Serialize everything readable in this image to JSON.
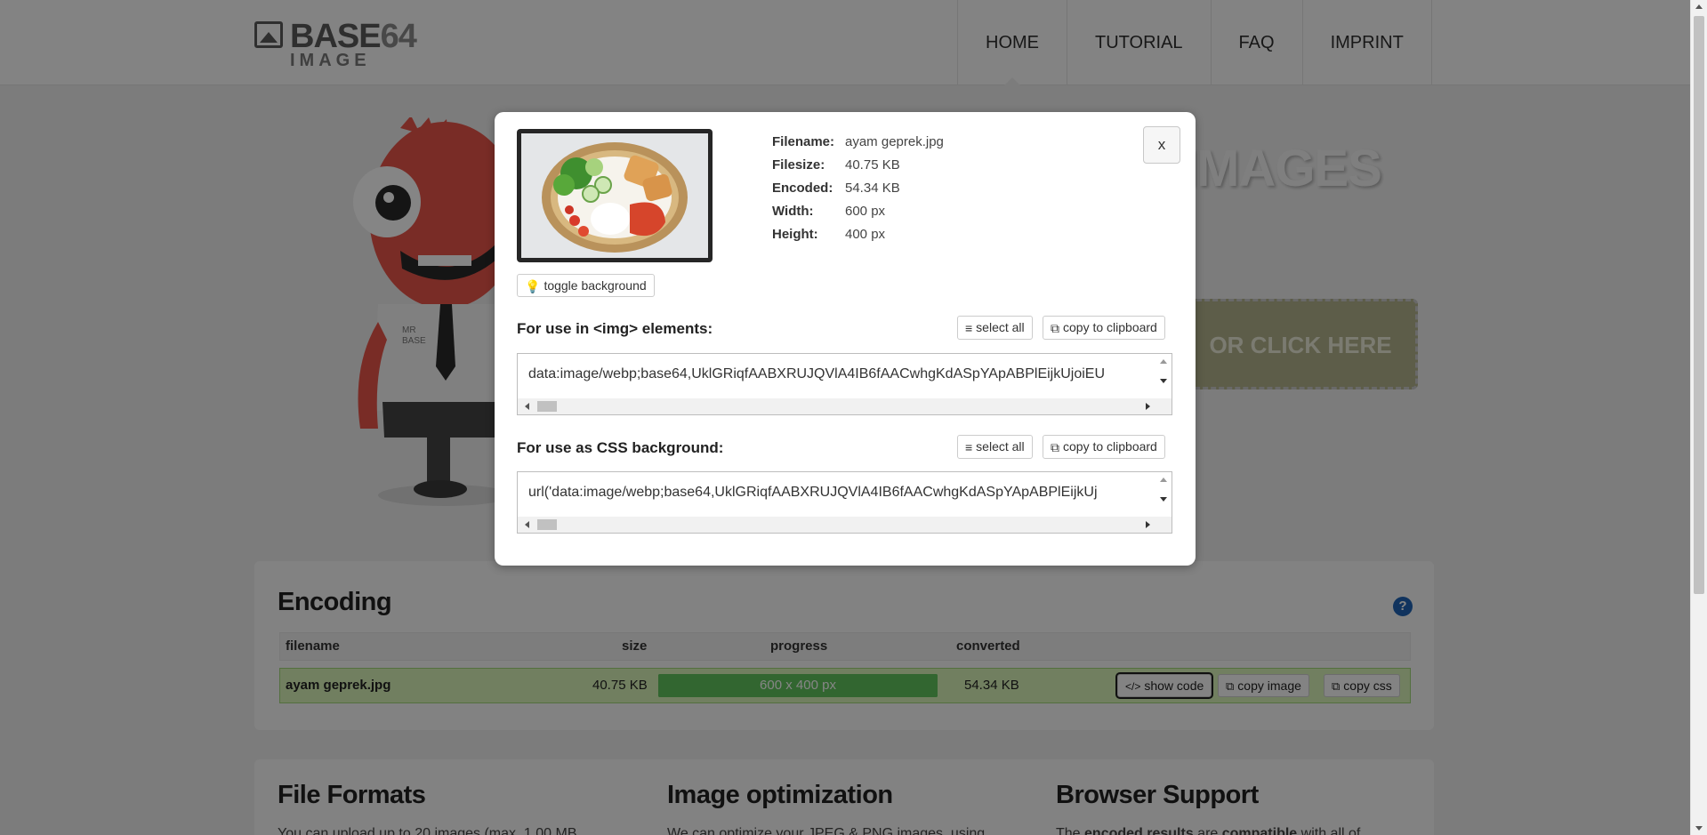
{
  "logo": {
    "main": "BASE",
    "suffix": "64",
    "sub": "IMAGE"
  },
  "nav": [
    {
      "label": "HOME",
      "active": true
    },
    {
      "label": "TUTORIAL",
      "active": false
    },
    {
      "label": "FAQ",
      "active": false
    },
    {
      "label": "IMPRINT",
      "active": false
    }
  ],
  "hero": {
    "title": "IMAGES",
    "dropzone_label": "OR CLICK HERE",
    "mascot_badge": [
      "MR",
      "BASE"
    ]
  },
  "modal": {
    "meta": [
      {
        "key": "Filename:",
        "value": "ayam geprek.jpg"
      },
      {
        "key": "Filesize:",
        "value": "40.75 KB"
      },
      {
        "key": "Encoded:",
        "value": "54.34 KB"
      },
      {
        "key": "Width:",
        "value": "600 px"
      },
      {
        "key": "Height:",
        "value": "400 px"
      }
    ],
    "toggle_label": "toggle background",
    "close_label": "x",
    "img_section": {
      "label": "For use in <img> elements:",
      "select_all": "select all",
      "copy": "copy to clipboard",
      "code": "data:image/webp;base64,UklGRiqfAABXRUJQVlA4IB6fAACwhgKdASpYApABPlEijkUjoiEU"
    },
    "css_section": {
      "label": "For use as CSS background:",
      "select_all": "select all",
      "copy": "copy to clipboard",
      "code": "url('data:image/webp;base64,UklGRiqfAABXRUJQVlA4IB6fAACwhgKdASpYApABPlEijkUj"
    }
  },
  "encoding": {
    "title": "Encoding",
    "headers": {
      "filename": "filename",
      "size": "size",
      "progress": "progress",
      "converted": "converted"
    },
    "row": {
      "filename": "ayam geprek.jpg",
      "size": "40.75 KB",
      "progress_text": "600 x 400 px",
      "progress": 1.0,
      "converted": "54.34 KB",
      "show_code": "show code",
      "copy_image": "copy image",
      "copy_css": "copy css"
    }
  },
  "bottom": [
    {
      "title": "File Formats",
      "text": "You can upload up to 20 images (max. 1.00 MB"
    },
    {
      "title": "Image optimization",
      "text": "We can optimize your JPEG & PNG images, using"
    },
    {
      "title": "Browser Support",
      "text_pre": "The ",
      "text_b1": "encoded results",
      "text_mid": " are ",
      "text_b2": "compatible",
      "text_post": " with all of"
    }
  ],
  "colors": {
    "overlay": "#00000080",
    "progress": "#5cb85c",
    "row_bg": "#d9f3b9",
    "help_icon": "#1f63b4"
  }
}
